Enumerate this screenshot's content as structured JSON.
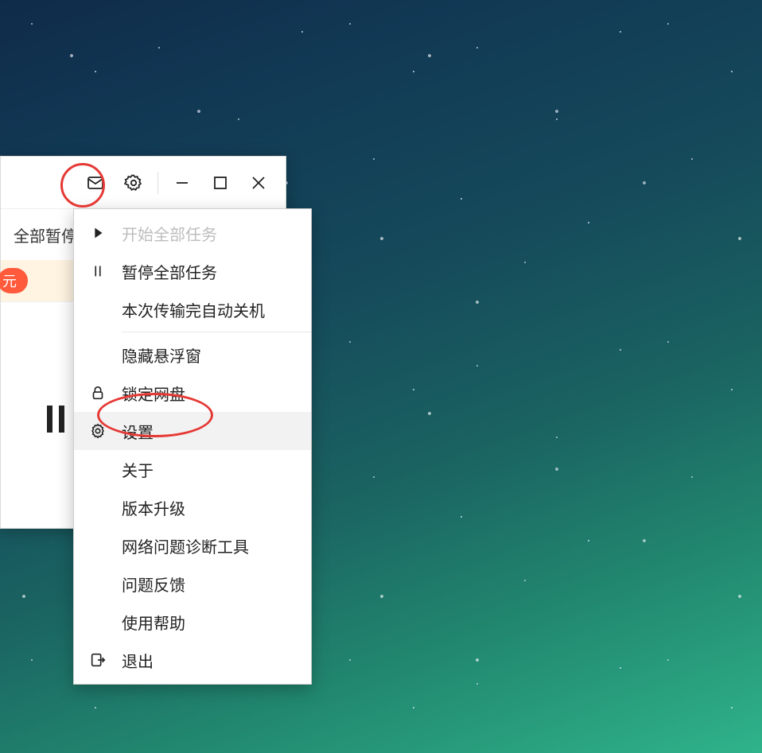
{
  "toolbar": {
    "pause_all_partial": "全部暂停"
  },
  "promo": {
    "badge_partial": "元"
  },
  "menu": {
    "start_all": "开始全部任务",
    "pause_all": "暂停全部任务",
    "auto_shutdown": "本次传输完自动关机",
    "hide_float": "隐藏悬浮窗",
    "lock_disk": "锁定网盘",
    "settings": "设置",
    "about": "关于",
    "upgrade": "版本升级",
    "net_diag": "网络问题诊断工具",
    "feedback": "问题反馈",
    "help": "使用帮助",
    "exit": "退出"
  }
}
